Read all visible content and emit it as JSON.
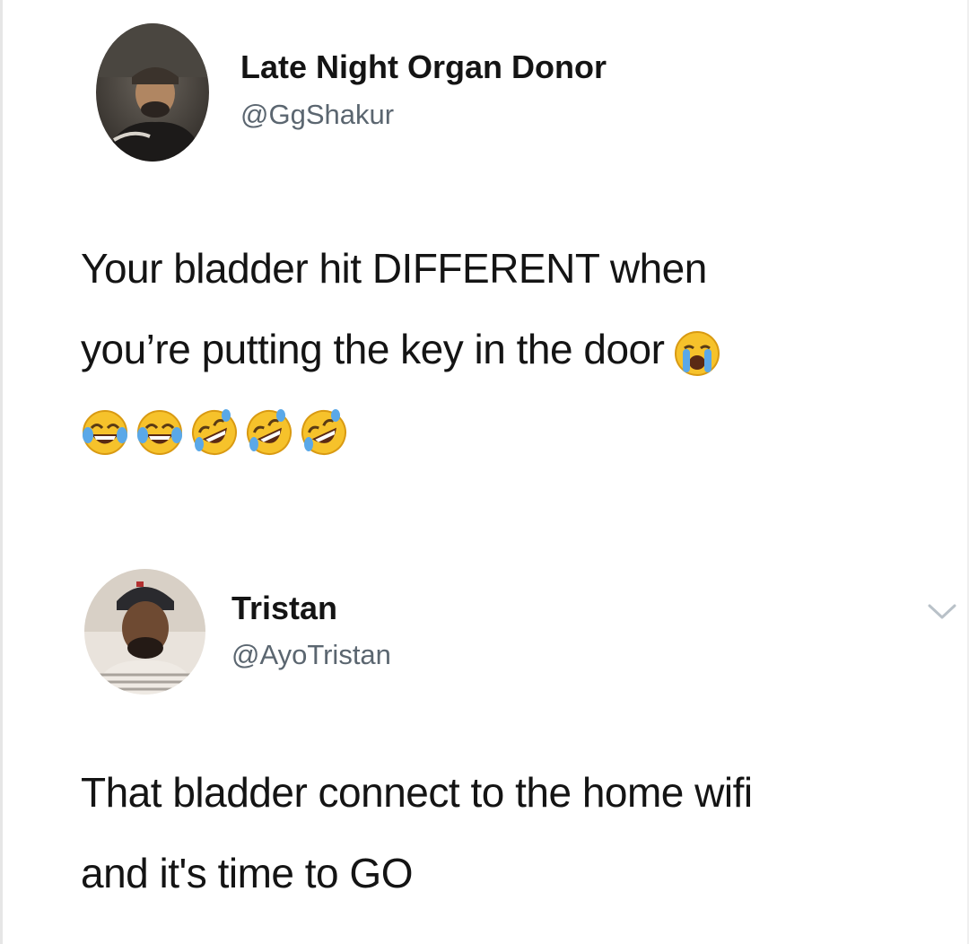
{
  "tweet": {
    "author": {
      "display_name": "Late Night Organ Donor",
      "handle": "@GgShakur"
    },
    "text_lines": [
      "Your bladder hit DIFFERENT when",
      "you’re putting the key in the door"
    ],
    "inline_emoji": "loudly-crying-face",
    "emoji_row": [
      "face-with-tears-of-joy",
      "face-with-tears-of-joy",
      "rolling-on-the-floor-laughing",
      "rolling-on-the-floor-laughing",
      "rolling-on-the-floor-laughing"
    ]
  },
  "reply": {
    "author": {
      "display_name": "Tristan",
      "handle": "@AyoTristan"
    },
    "text_lines": [
      "That bladder connect to the home wifi",
      "and it's time to GO"
    ],
    "menu_icon": "chevron-down-icon"
  },
  "colors": {
    "text": "#141414",
    "handle": "#5b6670",
    "emoji_yellow": "#f6c22b",
    "tear_blue": "#5aa8e8",
    "chevron": "#b9c1c8"
  }
}
